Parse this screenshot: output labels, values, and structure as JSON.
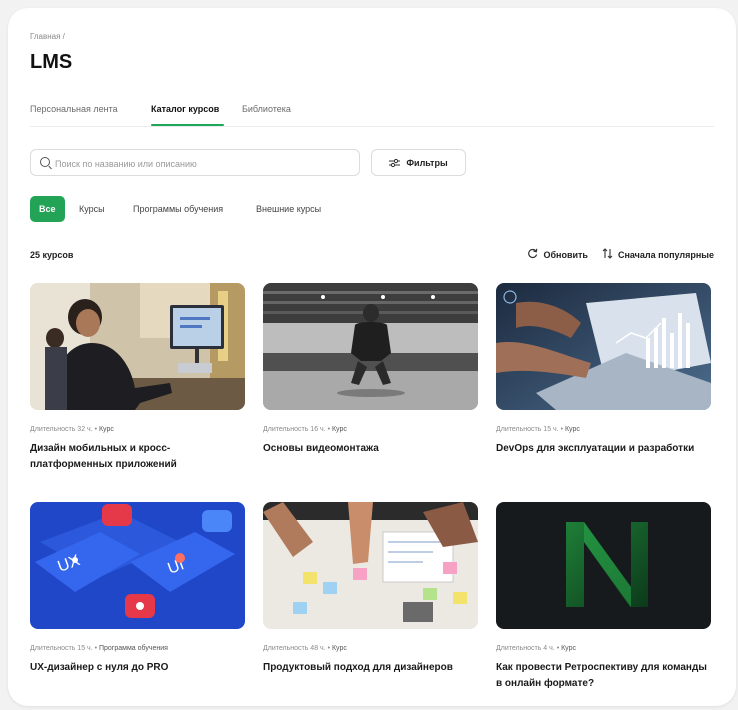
{
  "breadcrumb": "Главная /",
  "page_title": "LMS",
  "tabs": [
    {
      "label": "Персональная лента"
    },
    {
      "label": "Каталог курсов"
    },
    {
      "label": "Библиотека"
    }
  ],
  "search": {
    "placeholder": "Поиск по названию или описанию",
    "value": ""
  },
  "filter_button": "Фильтры",
  "chips": [
    {
      "label": "Все"
    },
    {
      "label": "Курсы"
    },
    {
      "label": "Программы обучения"
    },
    {
      "label": "Внешние курсы"
    }
  ],
  "count_label": "25 курсов",
  "refresh_label": "Обновить",
  "sort_label": "Сначала популярные",
  "accent_color": "#22a356",
  "courses": [
    {
      "duration": "Длительность 32 ч.",
      "type": "Курс",
      "title": "Дизайн мобильных и кросс-платформенных приложений",
      "image": "office-laptop-photo"
    },
    {
      "duration": "Длительность 16 ч.",
      "type": "Курс",
      "title": "Основы видеомонтажа",
      "image": "crouching-man-hall-photo"
    },
    {
      "duration": "Длительность 15 ч.",
      "type": "Курс",
      "title": "DevOps для эксплуатации и разработки",
      "image": "laptop-analytics-photo"
    },
    {
      "duration": "Длительность 15 ч.",
      "type": "Программа обучения",
      "title": "UX-дизайнер с нуля до PRO",
      "image": "ux-phones-illustration"
    },
    {
      "duration": "Длительность 48 ч.",
      "type": "Курс",
      "title": "Продуктовый подход для дизайнеров",
      "image": "sticky-notes-table-photo"
    },
    {
      "duration": "Длительность 4 ч.",
      "type": "Курс",
      "title": "Как провести Ретроспективу для команды в онлайн формате?",
      "image": "green-n-logo-illustration"
    }
  ]
}
